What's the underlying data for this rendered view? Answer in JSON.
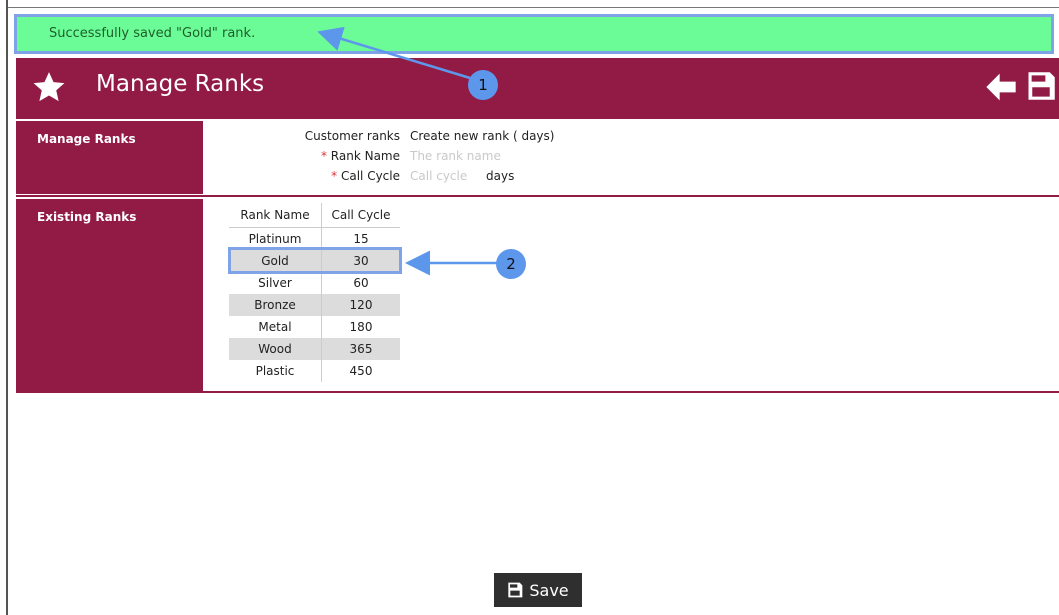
{
  "notification": {
    "text": "Successfully saved \"Gold\" rank."
  },
  "header": {
    "title": "Manage Ranks",
    "icons": {
      "title_icon": "star-icon",
      "back": "arrow-left-icon",
      "save": "floppy-disk-icon"
    }
  },
  "manage_section": {
    "label": "Manage Ranks",
    "customer_ranks_label": "Customer ranks",
    "customer_ranks_value": "Create new rank ( days)",
    "rank_name_label": "Rank Name",
    "rank_name_placeholder": "The rank name",
    "call_cycle_label": "Call Cycle",
    "call_cycle_placeholder": "Call cycle",
    "call_cycle_unit": "days",
    "required_marker": "*"
  },
  "existing_section": {
    "label": "Existing Ranks",
    "columns": [
      "Rank Name",
      "Call Cycle"
    ],
    "rows": [
      [
        "Platinum",
        "15"
      ],
      [
        "Gold",
        "30"
      ],
      [
        "Silver",
        "60"
      ],
      [
        "Bronze",
        "120"
      ],
      [
        "Metal",
        "180"
      ],
      [
        "Wood",
        "365"
      ],
      [
        "Plastic",
        "450"
      ]
    ]
  },
  "annotations": {
    "callout_1": "1",
    "callout_2": "2"
  },
  "footer": {
    "save_label": "Save"
  },
  "colors": {
    "brand": "#921b45",
    "success_bg": "#6cfc97",
    "annotation_blue": "#5d97ec"
  }
}
